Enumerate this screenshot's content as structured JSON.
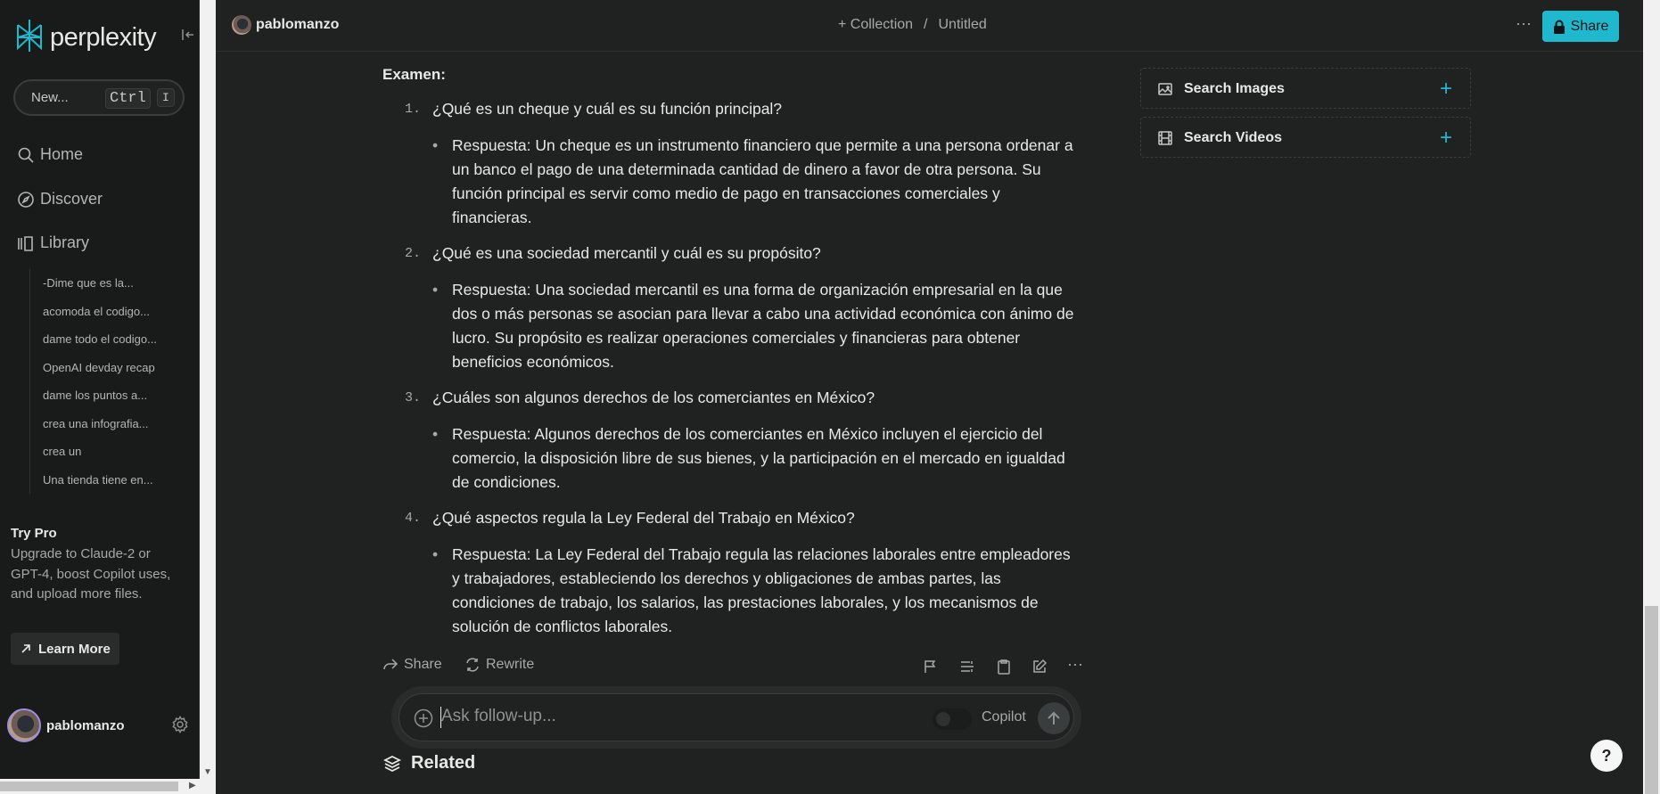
{
  "sidebar": {
    "logo_text": "perplexity",
    "new_label": "New...",
    "kbd_ctrl": "Ctrl",
    "kbd_key": "I",
    "nav": [
      {
        "label": "Home"
      },
      {
        "label": "Discover"
      },
      {
        "label": "Library"
      }
    ],
    "library_items": [
      "-Dime que es la...",
      "acomoda el codigo...",
      "dame todo el codigo...",
      "OpenAI devday recap",
      "dame los puntos a...",
      "crea una infografia...",
      "crea un",
      "Una tienda tiene en..."
    ],
    "trypro": {
      "title": "Try Pro",
      "body": "Upgrade to Claude-2 or GPT-4, boost Copilot uses, and upload more files.",
      "button": "Learn More"
    },
    "user": "pablomanzo"
  },
  "topbar": {
    "user": "pablomanzo",
    "collection": "+ Collection",
    "separator": "/",
    "title": "Untitled",
    "share": "Share"
  },
  "answer": {
    "heading": "Examen:",
    "items": [
      {
        "num": "1.",
        "question": "¿Qué es un cheque y cuál es su función principal?",
        "answer": "Respuesta: Un cheque es un instrumento financiero que permite a una persona ordenar a un banco el pago de una determinada cantidad de dinero a favor de otra persona. Su función principal es servir como medio de pago en transacciones comerciales y financieras."
      },
      {
        "num": "2.",
        "question": "¿Qué es una sociedad mercantil y cuál es su propósito?",
        "answer": "Respuesta: Una sociedad mercantil es una forma de organización empresarial en la que dos o más personas se asocian para llevar a cabo una actividad económica con ánimo de lucro. Su propósito es realizar operaciones comerciales y financieras para obtener beneficios económicos."
      },
      {
        "num": "3.",
        "question": "¿Cuáles son algunos derechos de los comerciantes en México?",
        "answer": "Respuesta: Algunos derechos de los comerciantes en México incluyen el ejercicio del comercio, la disposición libre de sus bienes, y la participación en el mercado en igualdad de condiciones."
      },
      {
        "num": "4.",
        "question": "¿Qué aspectos regula la Ley Federal del Trabajo en México?",
        "answer": "Respuesta: La Ley Federal del Trabajo regula las relaciones laborales entre empleadores y trabajadores, estableciendo los derechos y obligaciones de ambas partes, las condiciones de trabajo, los salarios, las prestaciones laborales, y los mecanismos de solución de conflictos laborales."
      }
    ]
  },
  "actions": {
    "share": "Share",
    "rewrite": "Rewrite"
  },
  "followup": {
    "placeholder": "Ask follow-up...",
    "copilot": "Copilot"
  },
  "related": "Related",
  "side": {
    "search_images": "Search Images",
    "search_videos": "Search Videos"
  },
  "help": "?",
  "colors": {
    "accent": "#20b8cd",
    "background": "#202222",
    "sidebar": "#191a1a"
  }
}
